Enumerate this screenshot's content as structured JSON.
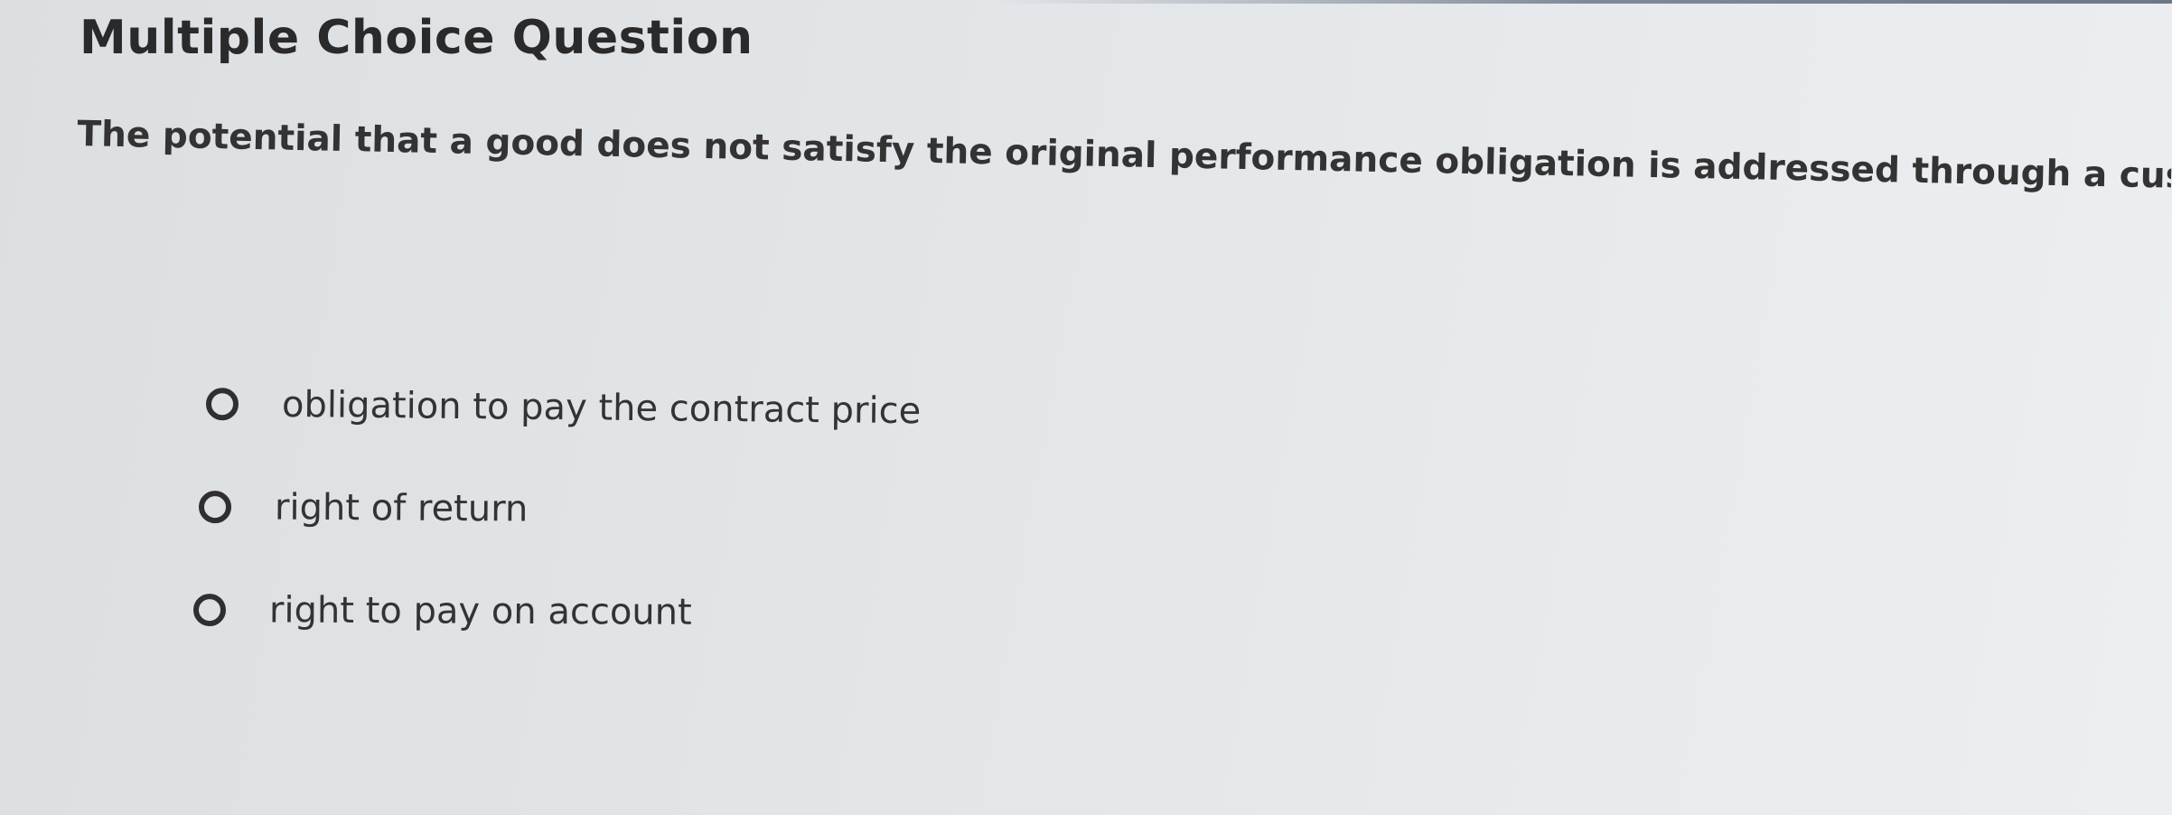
{
  "question": {
    "heading": "Multiple Choice Question",
    "prompt": "The potential that a good does not satisfy the original performance obligation is addressed through a custome"
  },
  "options": [
    {
      "label": "obligation to pay the contract price",
      "selected": false
    },
    {
      "label": "right of return",
      "selected": false
    },
    {
      "label": "right to pay on account",
      "selected": false
    }
  ]
}
